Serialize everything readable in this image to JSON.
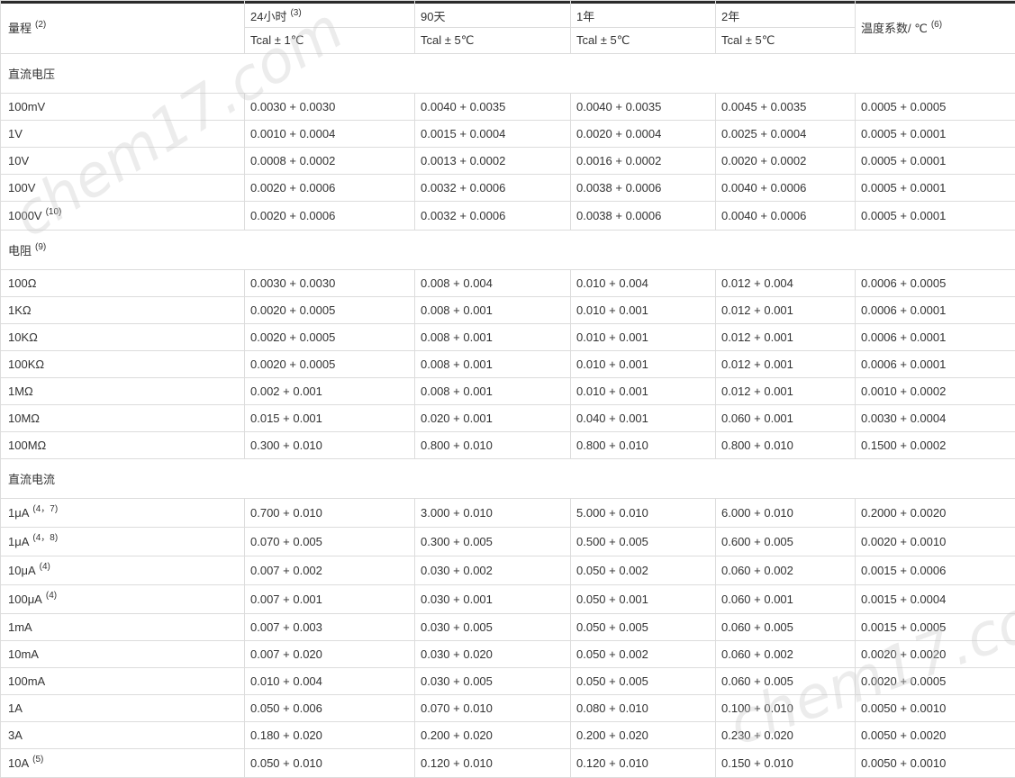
{
  "header": {
    "range_label": "量程",
    "range_note": "(2)",
    "periods": [
      {
        "label": "24小时",
        "note": "(3)",
        "cond": "Tcal ± 1℃"
      },
      {
        "label": "90天",
        "note": "",
        "cond": "Tcal ± 5℃"
      },
      {
        "label": "1年",
        "note": "",
        "cond": "Tcal ± 5℃"
      },
      {
        "label": "2年",
        "note": "",
        "cond": "Tcal ± 5℃"
      }
    ],
    "temp_label": "温度系数/ ℃",
    "temp_note": "(6)"
  },
  "watermark_text": "chem17.com",
  "sections": [
    {
      "title": "直流电压",
      "note": "",
      "rows": [
        {
          "range": "100mV",
          "note": "",
          "v": [
            "0.0030 + 0.0030",
            "0.0040 + 0.0035",
            "0.0040 + 0.0035",
            "0.0045 + 0.0035",
            "0.0005 + 0.0005"
          ]
        },
        {
          "range": "1V",
          "note": "",
          "v": [
            "0.0010 + 0.0004",
            "0.0015 + 0.0004",
            "0.0020 + 0.0004",
            "0.0025 + 0.0004",
            "0.0005 + 0.0001"
          ]
        },
        {
          "range": "10V",
          "note": "",
          "v": [
            "0.0008 + 0.0002",
            "0.0013 + 0.0002",
            "0.0016 + 0.0002",
            "0.0020 + 0.0002",
            "0.0005 + 0.0001"
          ]
        },
        {
          "range": "100V",
          "note": "",
          "v": [
            "0.0020 + 0.0006",
            "0.0032 + 0.0006",
            "0.0038 + 0.0006",
            "0.0040 + 0.0006",
            "0.0005 + 0.0001"
          ]
        },
        {
          "range": "1000V",
          "note": "(10)",
          "v": [
            "0.0020 + 0.0006",
            "0.0032 + 0.0006",
            "0.0038 + 0.0006",
            "0.0040 + 0.0006",
            "0.0005 + 0.0001"
          ]
        }
      ]
    },
    {
      "title": "电阻",
      "note": "(9)",
      "rows": [
        {
          "range": "100Ω",
          "note": "",
          "v": [
            "0.0030 + 0.0030",
            "0.008 + 0.004",
            "0.010 + 0.004",
            "0.012 + 0.004",
            "0.0006 + 0.0005"
          ]
        },
        {
          "range": "1KΩ",
          "note": "",
          "v": [
            "0.0020 + 0.0005",
            "0.008 + 0.001",
            "0.010 + 0.001",
            "0.012 + 0.001",
            "0.0006 + 0.0001"
          ]
        },
        {
          "range": "10KΩ",
          "note": "",
          "v": [
            "0.0020 + 0.0005",
            "0.008 + 0.001",
            "0.010 + 0.001",
            "0.012 + 0.001",
            "0.0006 + 0.0001"
          ]
        },
        {
          "range": "100KΩ",
          "note": "",
          "v": [
            "0.0020 + 0.0005",
            "0.008 + 0.001",
            "0.010 + 0.001",
            "0.012 + 0.001",
            "0.0006 + 0.0001"
          ]
        },
        {
          "range": "1MΩ",
          "note": "",
          "v": [
            "0.002 + 0.001",
            "0.008 + 0.001",
            "0.010 + 0.001",
            "0.012 + 0.001",
            "0.0010 + 0.0002"
          ]
        },
        {
          "range": "10MΩ",
          "note": "",
          "v": [
            "0.015 + 0.001",
            "0.020 + 0.001",
            "0.040 + 0.001",
            "0.060 + 0.001",
            "0.0030 + 0.0004"
          ]
        },
        {
          "range": "100MΩ",
          "note": "",
          "v": [
            "0.300 + 0.010",
            "0.800 + 0.010",
            "0.800 + 0.010",
            "0.800 + 0.010",
            "0.1500 + 0.0002"
          ]
        }
      ]
    },
    {
      "title": "直流电流",
      "note": "",
      "rows": [
        {
          "range": "1μA",
          "note": "(4，7)",
          "v": [
            "0.700 + 0.010",
            "3.000 + 0.010",
            "5.000 + 0.010",
            "6.000 + 0.010",
            "0.2000 + 0.0020"
          ]
        },
        {
          "range": "1μA",
          "note": "(4，8)",
          "v": [
            "0.070 + 0.005",
            "0.300 + 0.005",
            "0.500 + 0.005",
            "0.600 + 0.005",
            "0.0020 + 0.0010"
          ]
        },
        {
          "range": "10μA",
          "note": "(4)",
          "v": [
            "0.007 + 0.002",
            "0.030 + 0.002",
            "0.050 + 0.002",
            "0.060 + 0.002",
            "0.0015 + 0.0006"
          ]
        },
        {
          "range": "100μA",
          "note": "(4)",
          "v": [
            "0.007 + 0.001",
            "0.030 + 0.001",
            "0.050 + 0.001",
            "0.060 + 0.001",
            "0.0015 + 0.0004"
          ]
        },
        {
          "range": "1mA",
          "note": "",
          "v": [
            "0.007 + 0.003",
            "0.030 + 0.005",
            "0.050 + 0.005",
            "0.060 + 0.005",
            "0.0015 + 0.0005"
          ]
        },
        {
          "range": "10mA",
          "note": "",
          "v": [
            "0.007 + 0.020",
            "0.030 + 0.020",
            "0.050 + 0.002",
            "0.060 + 0.002",
            "0.0020 + 0.0020"
          ]
        },
        {
          "range": "100mA",
          "note": "",
          "v": [
            "0.010 + 0.004",
            "0.030 + 0.005",
            "0.050 + 0.005",
            "0.060 + 0.005",
            "0.0020 + 0.0005"
          ]
        },
        {
          "range": "1A",
          "note": "",
          "v": [
            "0.050 + 0.006",
            "0.070 + 0.010",
            "0.080 + 0.010",
            "0.100 + 0.010",
            "0.0050 + 0.0010"
          ]
        },
        {
          "range": "3A",
          "note": "",
          "v": [
            "0.180 + 0.020",
            "0.200 + 0.020",
            "0.200 + 0.020",
            "0.230 + 0.020",
            "0.0050 + 0.0020"
          ]
        },
        {
          "range": "10A",
          "note": "(5)",
          "v": [
            "0.050 + 0.010",
            "0.120 + 0.010",
            "0.120 + 0.010",
            "0.150 + 0.010",
            "0.0050 + 0.0010"
          ]
        }
      ]
    }
  ]
}
